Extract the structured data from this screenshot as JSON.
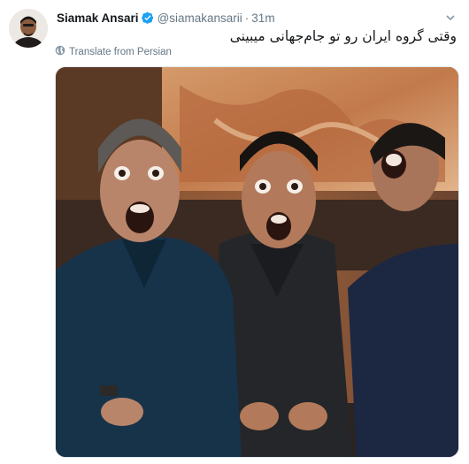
{
  "tweet": {
    "display_name": "Siamak Ansari",
    "handle": "@siamakansarii",
    "separator": "·",
    "time": "31m",
    "text": "وقتی گروه ایران رو تو جام‌جهانی میبینی",
    "translate_label": "Translate from Persian",
    "avatar_icon": "user-avatar",
    "verified_icon": "verified-badge-icon",
    "menu_icon": "chevron-down-icon",
    "globe_icon": "globe-icon"
  },
  "colors": {
    "name": "#14171a",
    "meta": "#657786",
    "verified": "#1da1f2",
    "border": "#e1e8ed"
  }
}
